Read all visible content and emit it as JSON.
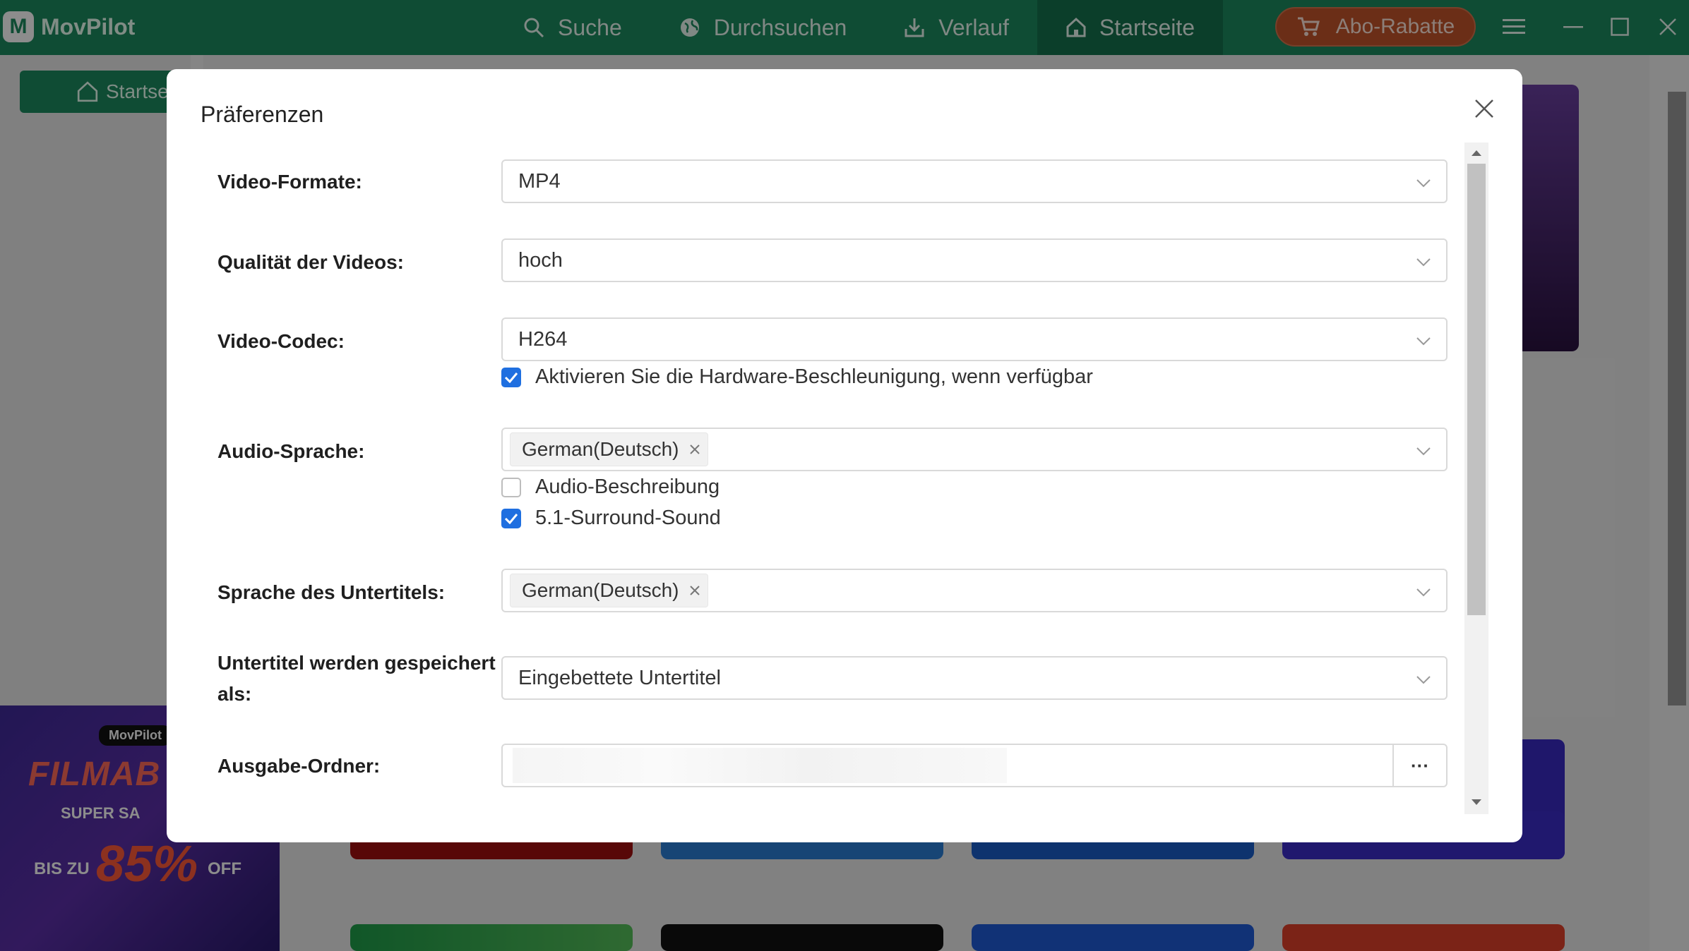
{
  "app": {
    "name": "MovPilot"
  },
  "nav": {
    "items": [
      {
        "label": "Suche",
        "icon": "search-icon"
      },
      {
        "label": "Durchsuchen",
        "icon": "globe-icon"
      },
      {
        "label": "Verlauf",
        "icon": "download-history-icon"
      },
      {
        "label": "Startseite",
        "icon": "home-icon",
        "active": true
      }
    ],
    "promo_label": "Abo-Rabatte"
  },
  "sidebar": {
    "home_label": "Startse"
  },
  "banner": {
    "tag": "MovPilot",
    "title": "FILMAB",
    "sale": "SUPER SA",
    "prefix": "BIS ZU",
    "percent": "85%",
    "suffix": "OFF"
  },
  "dialog": {
    "title": "Präferenzen",
    "video_format": {
      "label": "Video-Formate:",
      "value": "MP4"
    },
    "video_quality": {
      "label": "Qualität der Videos:",
      "value": "hoch"
    },
    "video_codec": {
      "label": "Video-Codec:",
      "value": "H264",
      "hw_accel": {
        "label": "Aktivieren Sie die Hardware-Beschleunigung, wenn verfügbar",
        "checked": true
      }
    },
    "audio_language": {
      "label": "Audio-Sprache:",
      "chip": "German(Deutsch)",
      "audio_description": {
        "label": "Audio-Beschreibung",
        "checked": false
      },
      "surround": {
        "label": "5.1-Surround-Sound",
        "checked": true
      }
    },
    "subtitle_language": {
      "label": "Sprache des Untertitels:",
      "chip": "German(Deutsch)"
    },
    "subtitle_save": {
      "label_line1": "Untertitel werden gespeichert",
      "label_line2": "als:",
      "value": "Eingebettete Untertitel"
    },
    "output_folder": {
      "label": "Ausgabe-Ordner:",
      "browse_label": "···"
    }
  },
  "colors": {
    "brand": "#1d8a5f",
    "checkbox": "#1f6fe0",
    "promo": "#c4542a"
  }
}
